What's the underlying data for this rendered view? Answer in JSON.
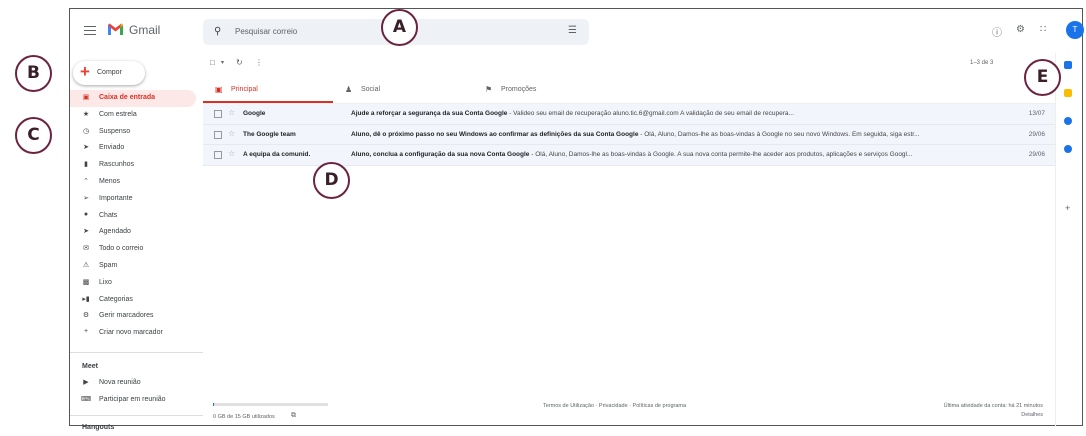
{
  "app": {
    "name": "Gmail",
    "avatar_letter": "T"
  },
  "search": {
    "placeholder": "Pesquisar correio"
  },
  "compose": {
    "label": "Compor"
  },
  "sidebar": {
    "items": [
      {
        "label": "Caixa de entrada",
        "icon": "inbox-icon",
        "active": true
      },
      {
        "label": "Com estrela",
        "icon": "star-icon"
      },
      {
        "label": "Suspenso",
        "icon": "clock-icon"
      },
      {
        "label": "Enviado",
        "icon": "send-icon"
      },
      {
        "label": "Rascunhos",
        "icon": "draft-icon"
      },
      {
        "label": "Menos",
        "icon": "chevron-up-icon"
      },
      {
        "label": "Importante",
        "icon": "important-icon"
      },
      {
        "label": "Chats",
        "icon": "chat-icon"
      },
      {
        "label": "Agendado",
        "icon": "scheduled-icon"
      },
      {
        "label": "Todo o correio",
        "icon": "all-mail-icon"
      },
      {
        "label": "Spam",
        "icon": "spam-icon"
      },
      {
        "label": "Lixo",
        "icon": "trash-icon"
      },
      {
        "label": "Categorias",
        "icon": "label-icon"
      },
      {
        "label": "Gerir marcadores",
        "icon": "gear-icon"
      },
      {
        "label": "Criar novo marcador",
        "icon": "plus-icon"
      }
    ],
    "meet": {
      "heading": "Meet",
      "items": [
        {
          "label": "Nova reunião",
          "icon": "video-icon"
        },
        {
          "label": "Participar em reunião",
          "icon": "keyboard-icon"
        }
      ]
    },
    "hangouts_heading": "Hangouts"
  },
  "toolbar": {
    "pagination": "1–3 de 3"
  },
  "tabs": [
    {
      "label": "Principal",
      "icon": "inbox-icon",
      "active": true
    },
    {
      "label": "Social",
      "icon": "people-icon"
    },
    {
      "label": "Promoções",
      "icon": "tag-icon"
    }
  ],
  "emails": [
    {
      "sender": "Google",
      "subject": "Ajude a reforçar a segurança da sua Conta Google",
      "snippet": " - Valideo seu email de recuperação aluno.tic.6@gmail.com A validação de seu email de recupera...",
      "date": "13/07"
    },
    {
      "sender": "The Google team",
      "subject": "Aluno, dê o próximo passo no seu Windows ao confirmar as definições da sua Conta Google",
      "snippet": " - Olá, Aluno, Damos-lhe as boas-vindas à Google no seu novo Windows. Em seguida, siga estr...",
      "date": "29/06"
    },
    {
      "sender": "A equipa da comunid.",
      "subject": "Aluno, conclua a configuração da sua nova Conta Google",
      "snippet": " - Olá, Aluno, Damos-lhe as boas-vindas à Google. A sua nova conta permite-lhe aceder aos produtos, aplicações e serviços Googl...",
      "date": "29/06"
    }
  ],
  "footer": {
    "storage": "0 GB de 15 GB utilizados",
    "storage_fraction": 0.01,
    "links": "Termos de Utilização · Privacidade · Políticas de programa",
    "activity": "Última atividade da conta: há 21 minutos",
    "details": "Detalhes"
  },
  "callouts": [
    "A",
    "B",
    "C",
    "D",
    "E"
  ],
  "colors": {
    "accent": "#d93025",
    "brand_blue": "#1a73e8",
    "callout_border": "#6b2340"
  }
}
